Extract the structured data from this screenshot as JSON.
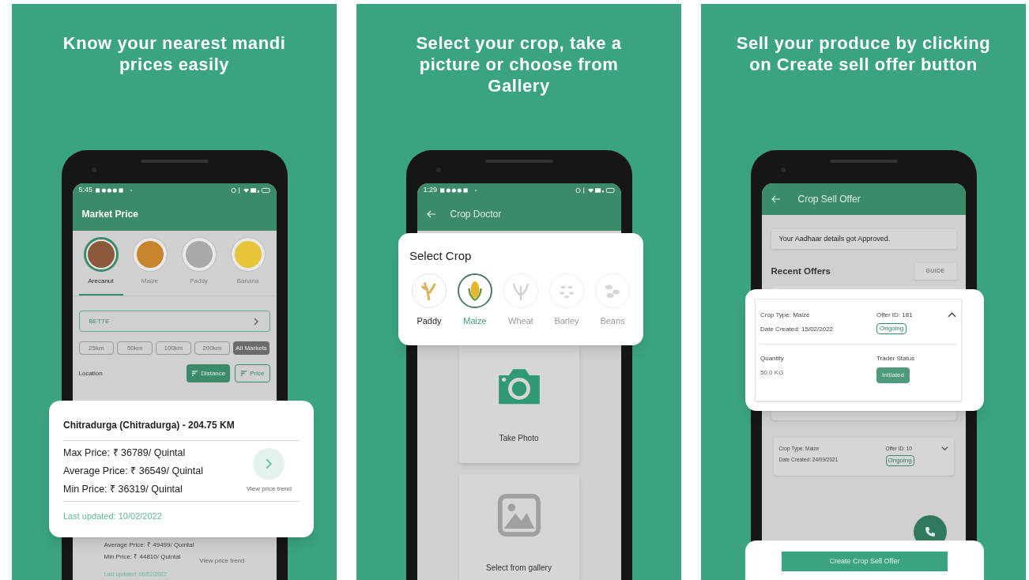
{
  "panels": [
    {
      "kind": "market",
      "headline": "Know your nearest mandi prices easily",
      "phone": {
        "time": "5:45",
        "title": "Market Price",
        "crops": [
          {
            "label": "Arecanut",
            "selected": true
          },
          {
            "label": "Maize",
            "selected": false
          },
          {
            "label": "Paddy",
            "selected": false
          },
          {
            "label": "Banana",
            "selected": false
          }
        ],
        "search": "BETTE",
        "radius": [
          {
            "label": "25km",
            "selected": false
          },
          {
            "label": "50km",
            "selected": false
          },
          {
            "label": "100km",
            "selected": false
          },
          {
            "label": "200km",
            "selected": false
          },
          {
            "label": "All Markets",
            "selected": true
          }
        ],
        "location_label": "Location",
        "sort": [
          {
            "label": "Distance",
            "selected": true
          },
          {
            "label": "Price",
            "selected": false
          }
        ],
        "behind_card": {
          "lines": [
            "Average Price: ₹ 49499/ Quintal",
            "Min Price: ₹ 44810/ Quintal"
          ],
          "trend": "View price trend",
          "updated": "Last updated: 06/02/2022"
        }
      },
      "card": {
        "title": "Chitradurga (Chitradurga) - 204.75 KM",
        "lines": [
          "Max Price: ₹ 36789/ Quintal",
          "Average Price: ₹ 36549/ Quintal",
          "Min Price: ₹ 36319/ Quintal"
        ],
        "trend": "View price trend",
        "updated": "Last updated: 10/02/2022"
      }
    },
    {
      "kind": "doctor",
      "headline": "Select your crop, take a picture or choose from Gallery",
      "phone": {
        "time": "1:29",
        "title": "Crop Doctor",
        "options": [
          "Take Photo",
          "Select from gallery"
        ]
      },
      "card": {
        "title": "Select Crop",
        "crops": [
          {
            "label": "Paddy",
            "selected": false,
            "disabled": false
          },
          {
            "label": "Maize",
            "selected": true,
            "disabled": false
          },
          {
            "label": "Wheat",
            "selected": false,
            "disabled": true
          },
          {
            "label": "Barley",
            "selected": false,
            "disabled": true
          },
          {
            "label": "Beans",
            "selected": false,
            "disabled": true
          }
        ]
      }
    },
    {
      "kind": "sell",
      "headline": "Sell your produce by clicking on Create sell offer button",
      "phone": {
        "title": "Crop Sell Offer",
        "notice": "Your Aadhaar details got Approved.",
        "section": "Recent Offers",
        "guide": "GUIDE",
        "offers": [
          {
            "crop": "Crop Type: Maize",
            "date": "Date Created: 24/09/2021",
            "offer_id": "Offer ID: 10",
            "status": "Ongoing",
            "expanded": false
          }
        ]
      },
      "card": {
        "crop": "Crop Type: Maize",
        "date": "Date Created: 15/02/2022",
        "offer_id": "Offer ID: 181",
        "status": "Ongoing",
        "expanded": true,
        "quantity_label": "Quantity",
        "quantity": "50.0 KG",
        "trader_label": "Trader Status",
        "trader_status": "Initiated"
      },
      "button": "Create Crop Sell Offer"
    }
  ]
}
